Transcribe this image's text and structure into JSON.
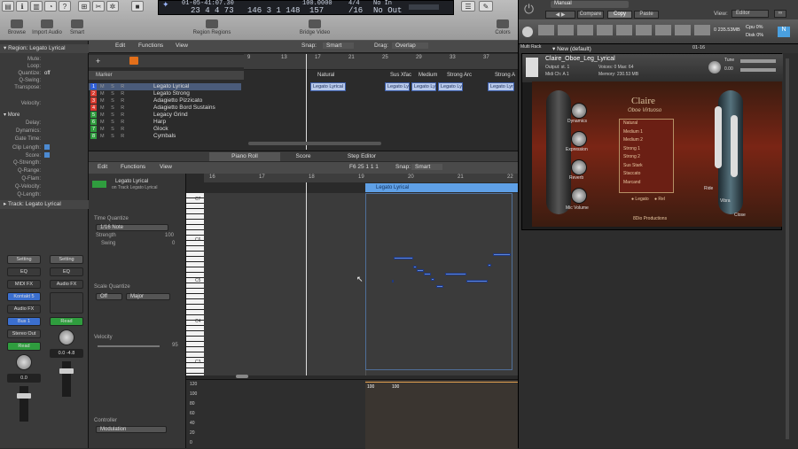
{
  "transport": {
    "lcd_top": "01-05-41:07.30",
    "bar": "23 4 4 73",
    "pos": "146 3 1 148",
    "tempo": "157",
    "tempo_label": "100.0000",
    "sig": "/16",
    "sig_top": "4/4",
    "out": "No Out",
    "in": "No In"
  },
  "toolbar": {
    "tools": [
      "Browse",
      "Import Audio",
      "Smart",
      "Region Regions",
      "Bridge Video",
      "Colors"
    ]
  },
  "inspector": {
    "title": "Region: Legato Lyrical",
    "fields": [
      {
        "k": "Mute:",
        "v": ""
      },
      {
        "k": "Loop:",
        "v": ""
      },
      {
        "k": "Quantize:",
        "v": "off"
      },
      {
        "k": "Q-Swing:",
        "v": ""
      },
      {
        "k": "Transpose:",
        "v": ""
      },
      {
        "k": "Velocity:",
        "v": ""
      }
    ],
    "more_label": "More",
    "more_fields": [
      {
        "k": "Delay:",
        "v": ""
      },
      {
        "k": "Dynamics:",
        "v": ""
      },
      {
        "k": "Gate Time:",
        "v": ""
      },
      {
        "k": "Clip Length:",
        "v": ""
      },
      {
        "k": "Score:",
        "v": ""
      },
      {
        "k": "Q-Strength:",
        "v": ""
      },
      {
        "k": "Q-Range:",
        "v": ""
      },
      {
        "k": "Q-Flam:",
        "v": ""
      },
      {
        "k": "Q-Velocity:",
        "v": ""
      },
      {
        "k": "Q-Length:",
        "v": ""
      }
    ],
    "track_label": "Track: Legato Lyrical",
    "setting_label": "Setting",
    "eq_label": "EQ",
    "midi_fx": "MIDI FX",
    "audio_fx": "Audio FX",
    "kontakt_btn": "Kontakt 5",
    "bus": "Bus 1",
    "stereo_out": "Stereo Out",
    "read": "Read",
    "val_a": "0.0",
    "val_b": "0.0",
    "val_c": "-4.8"
  },
  "tracks": {
    "menus": [
      "Edit",
      "Functions",
      "View"
    ],
    "marker_label": "Marker",
    "snap_label": "Snap:",
    "snap_value": "Smart",
    "drag_label": "Drag:",
    "drag_value": "Overlap",
    "list": [
      {
        "num": "1",
        "name": "Legato Lyrical",
        "color": "#2f5fd8"
      },
      {
        "num": "2",
        "name": "Legato Strong",
        "color": "#d83a2f"
      },
      {
        "num": "3",
        "name": "Adagietto Pizzicato",
        "color": "#d83a2f"
      },
      {
        "num": "4",
        "name": "Adagietto Bord Sustains",
        "color": "#d83a2f"
      },
      {
        "num": "5",
        "name": "Legacy Grind",
        "color": "#2f9d3e"
      },
      {
        "num": "6",
        "name": "Harp",
        "color": "#2f9d3e"
      },
      {
        "num": "7",
        "name": "Glock",
        "color": "#2f9d3e"
      },
      {
        "num": "8",
        "name": "Cymbals",
        "color": "#2f9d3e"
      }
    ],
    "msr": "M S R",
    "ruler": [
      "9",
      "13",
      "17",
      "21",
      "25",
      "29",
      "33",
      "37"
    ],
    "markers": [
      "Natural",
      "Sus Xfac",
      "Medium",
      "Strong Arc",
      "Strong A"
    ],
    "regions": [
      "Legato Lyrical",
      "Legato Lyr",
      "Legato Lyr",
      "Legato Lyr",
      "Legato Lyr"
    ]
  },
  "editor": {
    "tabs": [
      "Piano Roll",
      "Score",
      "Step Editor"
    ],
    "menus": [
      "Edit",
      "Functions",
      "View"
    ],
    "position": "F6  25 1 1 1",
    "snap_label": "Snap:",
    "snap_value": "Smart",
    "region_name": "Legato Lyrical",
    "region_sub": "on Track Legato Lyrical",
    "time_quantize": "Time Quantize",
    "tq_value": "1/16 Note",
    "strength": "Strength",
    "strength_val": "100",
    "swing": "Swing",
    "swing_val": "0",
    "scale_quantize": "Scale Quantize",
    "sq_off": "Off",
    "sq_major": "Major",
    "velocity": "Velocity",
    "velocity_val": "95",
    "controller": "Controller",
    "controller_val": "Modulation",
    "ruler": [
      "16",
      "17",
      "18",
      "19",
      "20",
      "21",
      "22"
    ],
    "region_label": "Legato Lyrical",
    "octaves": [
      "C7",
      "C6",
      "C5",
      "C4",
      "C3"
    ],
    "ctrl_ticks": [
      "120",
      "100",
      "80",
      "60",
      "40",
      "20",
      "0"
    ],
    "ctrl_vals": [
      "100",
      "100"
    ]
  },
  "plugin": {
    "preset": "Manual",
    "compare": "Compare",
    "copy": "Copy",
    "paste": "Paste",
    "view_label": "View:",
    "view_value": "Editor",
    "multi_rack": "Multi Rack",
    "rack_range": "01-16",
    "multi_name": "New (default)",
    "instrument": "Claire_Oboe_Leg_Lyrical",
    "output": "st. 1",
    "midi_ch": "A 1",
    "voices": "0",
    "max": "64",
    "memory": "230.53 MB",
    "tune": "Tune",
    "tune_val": "0.00",
    "cpu": "0%",
    "disk": "0%",
    "mem_top": "0 235.53MB",
    "logo_title": "Claire",
    "logo_sub": "Oboe Virtuoso",
    "articulations": [
      "Natural",
      "Medium 1",
      "Medium 2",
      "Strong 1",
      "Strong 2",
      "Sus Stark",
      "Staccato",
      "Marcand"
    ],
    "dials": [
      "Dynamics",
      "Expression",
      "Reverb",
      "Mic Volume"
    ],
    "right_labels": [
      "Ride",
      "Vibra",
      "Close"
    ],
    "footer": "8Dio Productions",
    "bottom_tabs": [
      "Legato",
      "Rel"
    ]
  }
}
